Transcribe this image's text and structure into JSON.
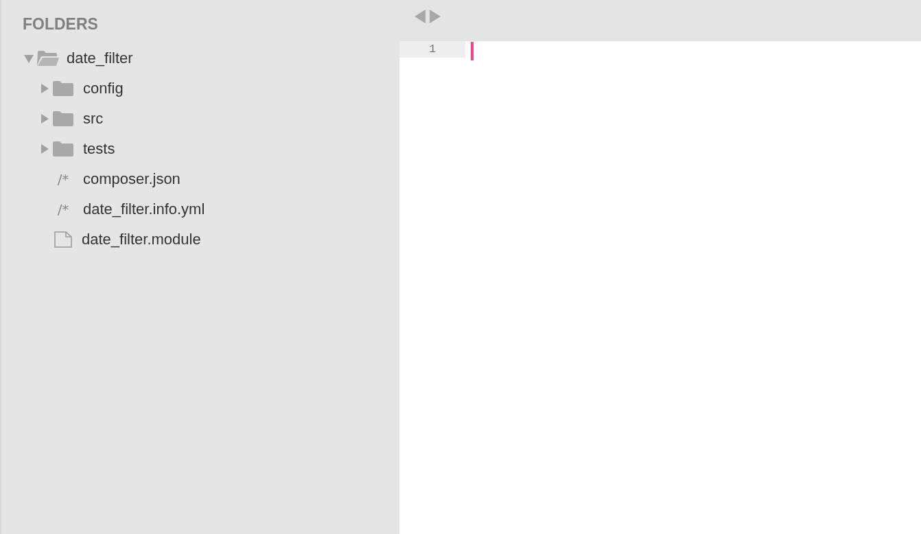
{
  "sidebar": {
    "header": "FOLDERS",
    "tree": [
      {
        "kind": "folder",
        "name": "date_filter",
        "expanded": true,
        "children": [
          {
            "kind": "folder",
            "name": "config",
            "expanded": false
          },
          {
            "kind": "folder",
            "name": "src",
            "expanded": false
          },
          {
            "kind": "folder",
            "name": "tests",
            "expanded": false
          },
          {
            "kind": "code",
            "glyph": "/*",
            "name": "composer.json"
          },
          {
            "kind": "code",
            "glyph": "/*",
            "name": "date_filter.info.yml"
          },
          {
            "kind": "file",
            "name": "date_filter.module"
          }
        ]
      }
    ]
  },
  "editor": {
    "line_numbers": [
      "1"
    ]
  }
}
